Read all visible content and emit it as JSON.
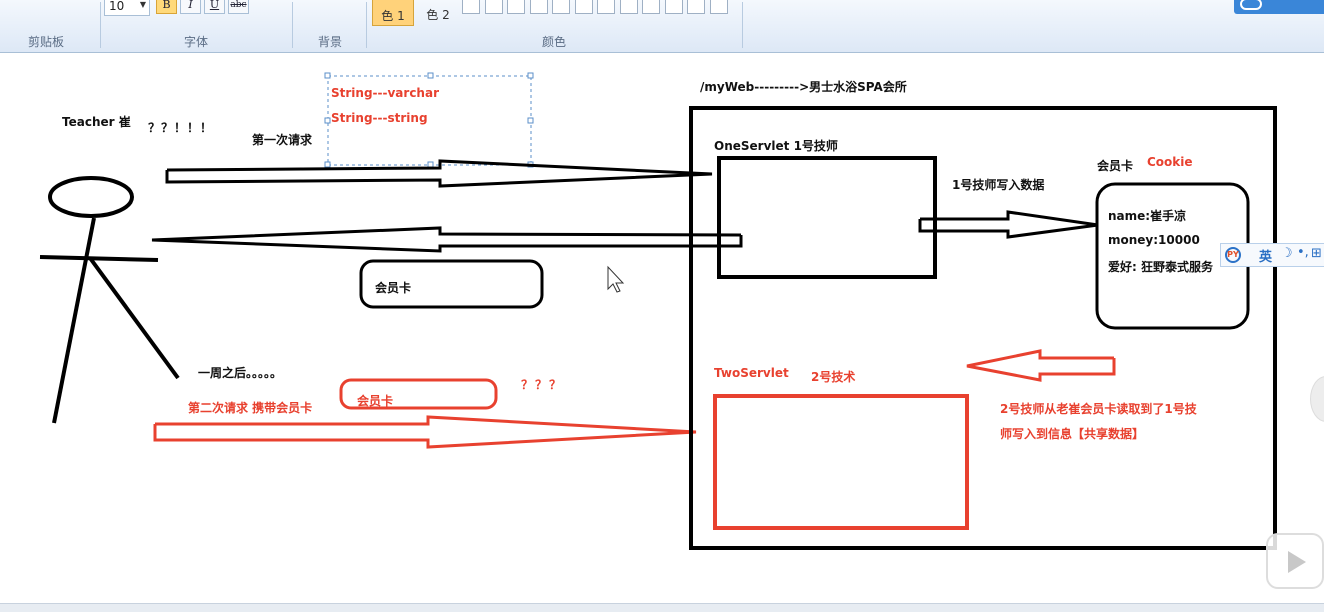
{
  "ribbon": {
    "groups": {
      "clipboard": "剪贴板",
      "font": "字体",
      "background": "背景",
      "colors": "颜色"
    },
    "font_size": "10",
    "bold_label": "B",
    "italic_label": "I",
    "underline_label": "U",
    "strike_label": "abc",
    "color1_label": "色 1",
    "color2_label": "色 2",
    "swatch_count": 12
  },
  "canvas": {
    "annotation_box": {
      "line1": "String---varchar",
      "line2": "String---string"
    },
    "teacher_label": "Teacher 崔",
    "question_marks": "？？！！！",
    "first_request": "第一次请求",
    "card_label_mid": "会员卡",
    "week_later": "一周之后。。。。。",
    "second_request": "第二次请求 携带会员卡",
    "card_label_low": "会员卡",
    "question_marks_2": "？？？",
    "server_title": "/myWeb--------->男士水浴SPA会所",
    "one_servlet": "OneServlet  1号技师",
    "tech1_write": "1号技师写入数据",
    "member_card": "会员卡",
    "cookie": "Cookie",
    "card_name": "name:崔手凉",
    "card_money": "money:10000",
    "card_hobby": "爱好: 狂野泰式服务",
    "two_servlet": "TwoServlet",
    "tech2": "2号技术",
    "tech2_note_line1": "2号技师从老崔会员卡读取到了1号技",
    "tech2_note_line2": "师写入到信息【共享数据】"
  },
  "ime": {
    "logo": "PY",
    "lang": "英",
    "moon": "☽",
    "punct": "•,",
    "extra": "⊞"
  },
  "colors": {
    "ribbon_bg": "#dde8f6",
    "red": "#e8412f",
    "black": "#000000",
    "accent_blue": "#3a86d8"
  }
}
